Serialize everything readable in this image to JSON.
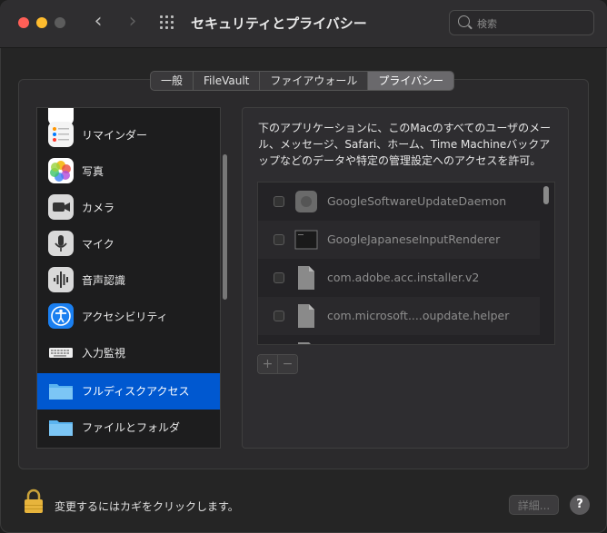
{
  "window": {
    "title": "セキュリティとプライバシー"
  },
  "search": {
    "placeholder": "検索"
  },
  "tabs": [
    {
      "label": "一般",
      "active": false
    },
    {
      "label": "FileVault",
      "active": false
    },
    {
      "label": "ファイアウォール",
      "active": false
    },
    {
      "label": "プライバシー",
      "active": true
    }
  ],
  "sidebar": {
    "items": [
      {
        "label": "リマインダー",
        "icon": "reminders-icon"
      },
      {
        "label": "写真",
        "icon": "photos-icon"
      },
      {
        "label": "カメラ",
        "icon": "camera-icon"
      },
      {
        "label": "マイク",
        "icon": "microphone-icon"
      },
      {
        "label": "音声認識",
        "icon": "speech-recognition-icon"
      },
      {
        "label": "アクセシビリティ",
        "icon": "accessibility-icon"
      },
      {
        "label": "入力監視",
        "icon": "keyboard-icon"
      },
      {
        "label": "フルディスクアクセス",
        "icon": "folder-icon",
        "selected": true
      },
      {
        "label": "ファイルとフォルダ",
        "icon": "folder-icon"
      }
    ]
  },
  "main": {
    "description": "下のアプリケーションに、このMacのすべてのユーザのメール、メッセージ、Safari、ホーム、Time Machineバックアップなどのデータや特定の管理設定へのアクセスを許可。",
    "apps": [
      {
        "label": "GoogleSoftwareUpdateDaemon",
        "checked": false,
        "icon": "app-generic-icon"
      },
      {
        "label": "GoogleJapaneseInputRenderer",
        "checked": false,
        "icon": "terminal-exec-icon"
      },
      {
        "label": "com.adobe.acc.installer.v2",
        "checked": false,
        "icon": "document-icon"
      },
      {
        "label": "com.microsoft....oupdate.helper",
        "checked": false,
        "icon": "document-icon"
      }
    ],
    "add_label": "+",
    "remove_label": "−"
  },
  "footer": {
    "lock_text": "変更するにはカギをクリックします。",
    "details_label": "詳細...",
    "help_label": "?"
  },
  "colors": {
    "selected": "#0058d0",
    "close": "#ff5f57",
    "minimize": "#febc2e"
  }
}
